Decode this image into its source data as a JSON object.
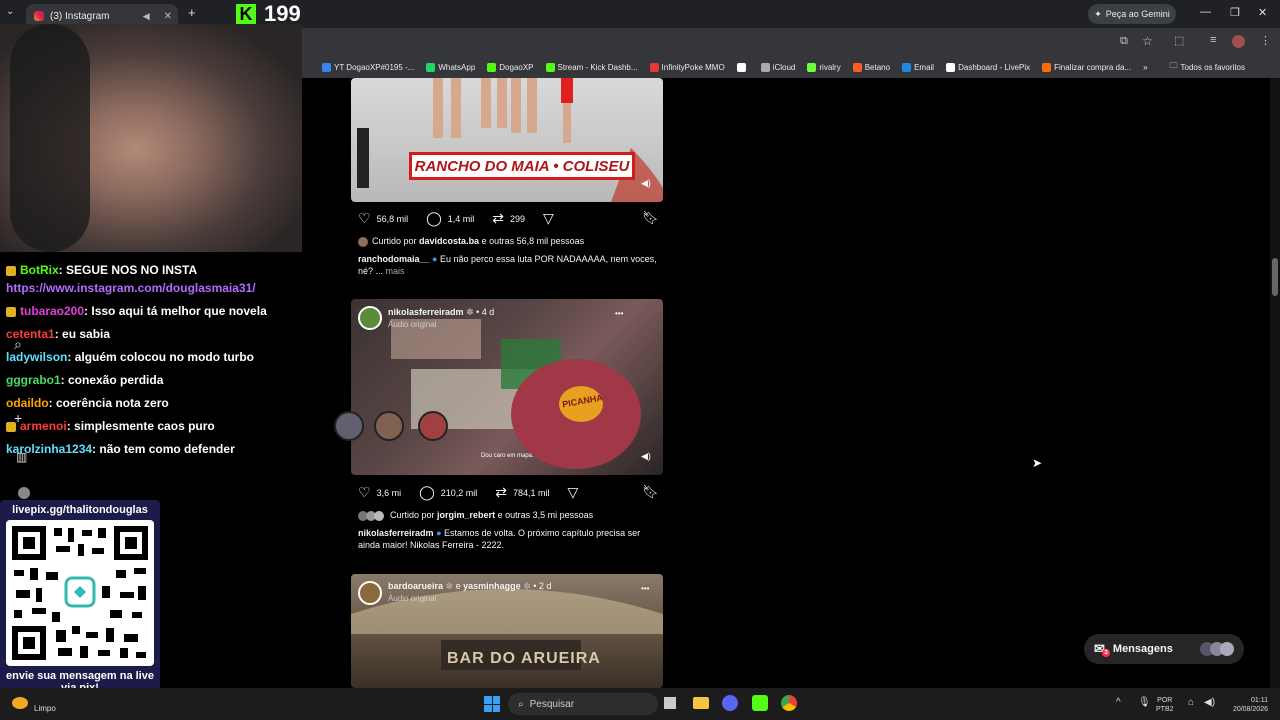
{
  "browser": {
    "tab_title": "(3) Instagram",
    "kick_viewers": "199",
    "gemini_label": "Peça ao Gemini",
    "bookmarks": [
      {
        "label": "YT DogaoXP#0195 -...",
        "color": "#3b82f6"
      },
      {
        "label": "WhatsApp",
        "color": "#25d366"
      },
      {
        "label": "DogaoXP",
        "color": "#53fc18"
      },
      {
        "label": "Stream - Kick Dashb...",
        "color": "#53fc18"
      },
      {
        "label": "InfinityPoke MMO",
        "color": "#e53935"
      },
      {
        "label": "",
        "color": "#ffffff"
      },
      {
        "label": "iCloud",
        "color": "#aaaaaa"
      },
      {
        "label": "rivalry",
        "color": "#6cff3c"
      },
      {
        "label": "Betano",
        "color": "#ff5a1f"
      },
      {
        "label": "Email",
        "color": "#1e88e5"
      },
      {
        "label": "Dashboard - LivePix",
        "color": "#ffffff"
      },
      {
        "label": "Finalizar compra da...",
        "color": "#ff6d00"
      }
    ],
    "all_favorites": "Todos os favoritos"
  },
  "stream_chat": {
    "lines": [
      {
        "user": "BotRix",
        "user_color": "#53fc18",
        "text": ": SEGUE NOS NO INSTA",
        "badge": true
      },
      {
        "user": "",
        "user_color": "#b36bff",
        "text": "https://www.instagram.com/douglasmaia31/",
        "badge": false,
        "link": true
      },
      {
        "user": "tubarao200",
        "user_color": "#e83cdc",
        "text": ": Isso aqui tá melhor que novela",
        "badge": true
      },
      {
        "user": "cetenta1",
        "user_color": "#ff3b3b",
        "text": ": eu sabia",
        "badge": false
      },
      {
        "user": "ladywilson",
        "user_color": "#5fe0ff",
        "text": ": alguém colocou no modo turbo",
        "badge": false
      },
      {
        "user": "gggrabo1",
        "user_color": "#4cd964",
        "text": ": conexão perdida",
        "badge": false
      },
      {
        "user": "odaildo",
        "user_color": "#ffa500",
        "text": ": coerência nota zero",
        "badge": false
      },
      {
        "user": "armenoi",
        "user_color": "#ff3b3b",
        "text": ": simplesmente caos puro",
        "badge": true
      },
      {
        "user": "karolzinha1234",
        "user_color": "#5fe0ff",
        "text": ": não tem como defender",
        "badge": false
      }
    ]
  },
  "livepix": {
    "url": "livepix.gg/thalitondouglas",
    "message": "envie sua mensagem na live via pix!"
  },
  "feed": {
    "post1": {
      "banner": "RANCHO DO MAIA • COLISEU",
      "likes": "56,8 mil",
      "comments": "1,4 mil",
      "reposts": "299",
      "liked_prefix": "Curtido por",
      "liked_user": "davidcosta.ba",
      "liked_suffix": "e outras 56,8 mil pessoas",
      "caption_user": "ranchodomaia__",
      "caption_text": "Eu não perco essa luta POR NADAAAAA, nem voces, né? ...",
      "more": "mais"
    },
    "post2": {
      "user": "nikolasferreiradm",
      "time": "• 4 d",
      "audio": "Áudio original",
      "package_text": "PICANHA",
      "subtitle": "Dou caro em mapa.",
      "likes": "3,6 mi",
      "comments": "210,2 mil",
      "reposts": "784,1 mil",
      "liked_prefix": "Curtido por",
      "liked_user": "jorgim_rebert",
      "liked_suffix": "e outras 3,5 mi pessoas",
      "caption_user": "nikolasferreiradm",
      "caption_text": "Estamos de volta. O próximo capítulo precisa ser ainda maior! Nikolas Ferreira - 2222."
    },
    "post3": {
      "user": "bardoarueira",
      "coauthor_prefix": "e",
      "coauthor": "yasminhagge",
      "time": "• 2 d",
      "audio": "Áudio original",
      "sign": "BAR DO ARUEIRA"
    }
  },
  "messages": {
    "label": "Mensagens",
    "count": "3"
  },
  "weather": {
    "label": "Limpo"
  },
  "taskbar": {
    "search_placeholder": "Pesquisar",
    "lang": "POR",
    "layout": "PTB2",
    "time": "01:11",
    "date": "20/08/2026"
  }
}
